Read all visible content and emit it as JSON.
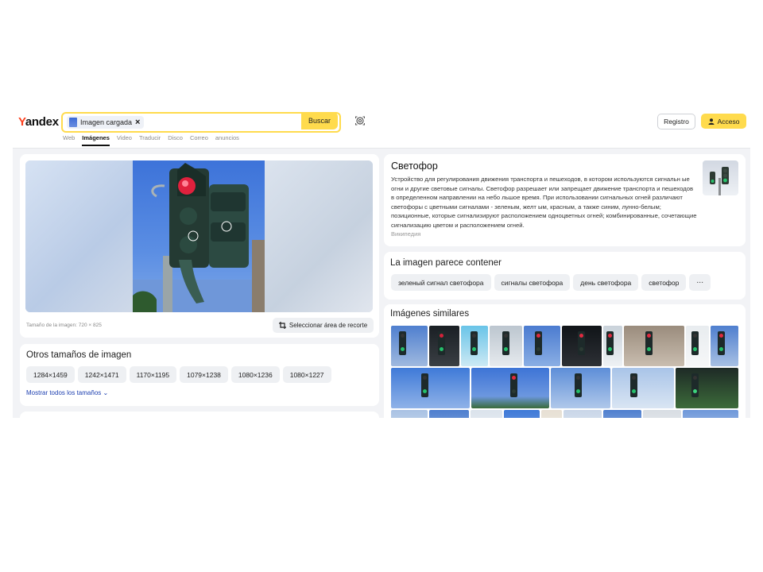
{
  "header": {
    "logo_y": "Y",
    "logo_rest": "andex",
    "chip_label": "Imagen cargada",
    "chip_close": "×",
    "search_button": "Buscar",
    "register": "Registro",
    "login": "Acceso",
    "tabs": [
      "Web",
      "Imágenes",
      "Video",
      "Traducir",
      "Disco",
      "Correo",
      "anuncios"
    ]
  },
  "main": {
    "image_size": "Tamaño de la imagen: 720 × 825",
    "crop_button": "Seleccionar área de recorte"
  },
  "sizes": {
    "title": "Otros tamaños de imagen",
    "items": [
      "1284×1459",
      "1242×1471",
      "1170×1195",
      "1079×1238",
      "1080×1236",
      "1080×1227"
    ],
    "show_all": "Mostrar todos los tamaños"
  },
  "info": {
    "title": "Светофор",
    "text": "Устройство для регулирования движения транспорта и пешеходов, в котором используются сигнальн ые огни и другие световые сигналы. Светофор разрешает или запрещает движение транспорта и пешеходов в определенном направлении на небо льшое время. При использовании сигнальных огней различают светофоры с цветными сигналами - зеленым, желт ым, красным, а также синим, лунно-белым; позиционные, которые сигнализируют расположением одноцветных огней; комбинированные, сочетающие сигнализацию цветом и расположением огней.",
    "source": "Википедия"
  },
  "contains": {
    "title": "La imagen parece contener",
    "tags": [
      "зеленый сигнал светофора",
      "сигналы светофора",
      "день светофора",
      "светофор"
    ],
    "more": "⋯"
  },
  "similar": {
    "title": "Imágenes similares"
  },
  "colors": {
    "accent": "#ffdb4d",
    "logo_red": "#fc3f1d",
    "link": "#1d3fb0",
    "background": "#f2f3f6"
  }
}
